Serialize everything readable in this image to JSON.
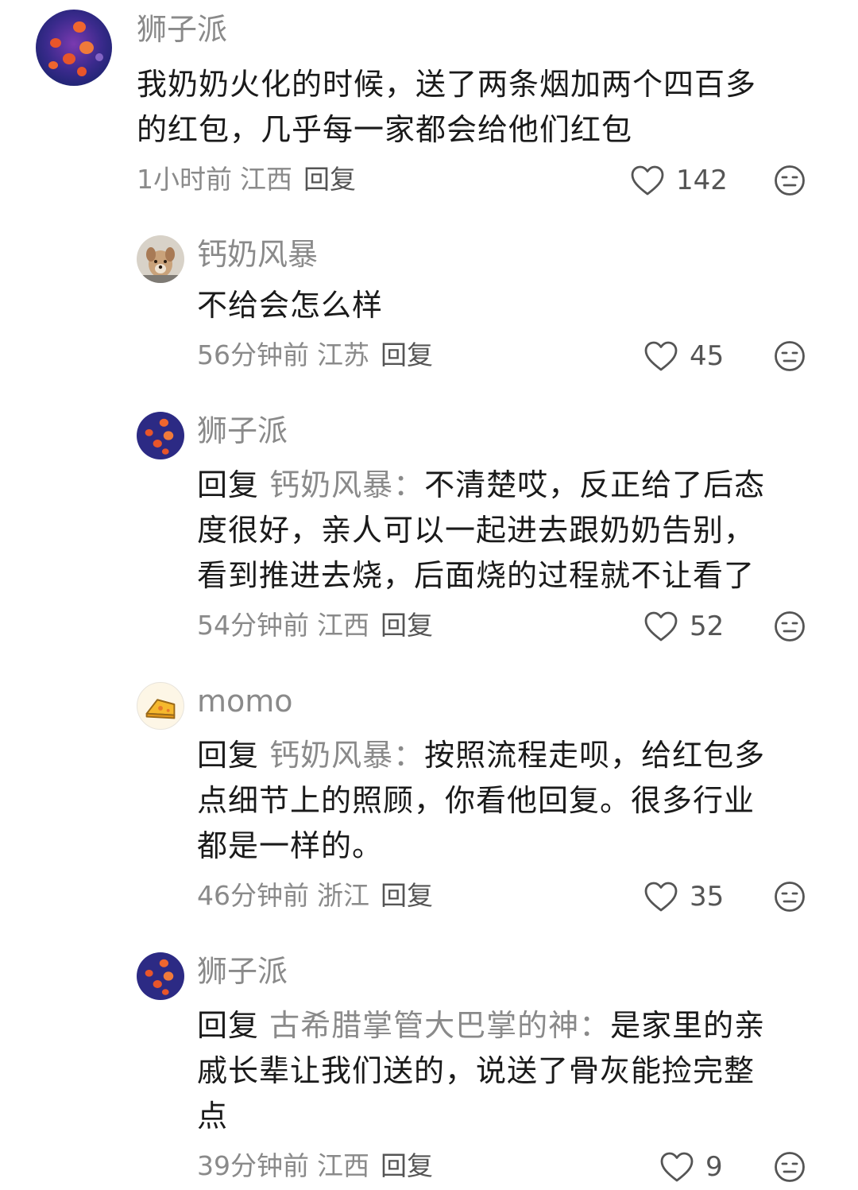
{
  "comments": [
    {
      "username": "狮子派",
      "text_lines": [
        "我奶奶火化的时候，送了两条烟加两个四百多",
        "的红包，几乎每一家都会给他们红包"
      ],
      "time": "1小时前",
      "location": "江西",
      "reply_label": "回复",
      "likes": "142",
      "avatar_icon": "jellyfish-avatar"
    },
    {
      "username": "钙奶风暴",
      "text_lines": [
        "不给会怎么样"
      ],
      "time": "56分钟前",
      "location": "江苏",
      "reply_label": "回复",
      "likes": "45",
      "avatar_icon": "dog-avatar"
    },
    {
      "username": "狮子派",
      "reply_prefix": "回复",
      "reply_target": "钙奶风暴：",
      "first_line_rest": "不清楚哎，反正给了后态",
      "text_lines": [
        "度很好，亲人可以一起进去跟奶奶告别，",
        "看到推进去烧，后面烧的过程就不让看了"
      ],
      "time": "54分钟前",
      "location": "江西",
      "reply_label": "回复",
      "likes": "52",
      "avatar_icon": "jellyfish-avatar"
    },
    {
      "username": "momo",
      "reply_prefix": "回复",
      "reply_target": "钙奶风暴：",
      "first_line_rest": "按照流程走呗，给红包多",
      "text_lines": [
        "点细节上的照顾，你看他回复。很多行业",
        "都是一样的。"
      ],
      "time": "46分钟前",
      "location": "浙江",
      "reply_label": "回复",
      "likes": "35",
      "avatar_icon": "cheese-avatar"
    },
    {
      "username": "狮子派",
      "reply_prefix": "回复",
      "reply_target": "古希腊掌管大巴掌的神：",
      "first_line_rest": "是家里的亲",
      "text_lines": [
        "戚长辈让我们送的，说送了骨灰能捡完整",
        "点"
      ],
      "time": "39分钟前",
      "location": "江西",
      "reply_label": "回复",
      "likes": "9",
      "avatar_icon": "jellyfish-avatar"
    }
  ],
  "colors": {
    "text": "#1a1a1a",
    "secondary": "#8a8a8a",
    "icon": "#555555",
    "jellyfish_bg": "#3a2a8c",
    "jellyfish": "#e8552a",
    "cheese": "#f5b82e"
  }
}
